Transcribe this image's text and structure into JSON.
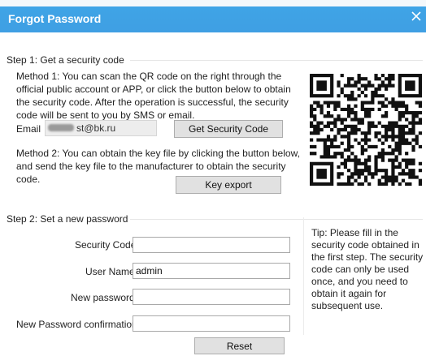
{
  "window": {
    "title": "Forgot Password",
    "close_icon": "close-icon",
    "colors": {
      "titlebar": "#3fa4e6",
      "title_text": "#ffffff"
    }
  },
  "step1": {
    "title": "Step 1: Get a security code",
    "method1_text": "Method 1: You can scan the QR code on the right through the official public account or APP, or click the button below to obtain the security code. After the operation is successful, the security code will be sent to you by SMS or email.",
    "email_label": "Email",
    "email_value": "st@bk.ru",
    "get_code_button": "Get Security Code",
    "method2_text": "Method 2: You can obtain the key file by clicking the button below, and send the key file to the manufacturer to obtain the security code.",
    "key_export_button": "Key export",
    "qr_code": "qr-code-image"
  },
  "step2": {
    "title": "Step 2: Set a new password",
    "security_code_label": "Security Code",
    "security_code_value": "",
    "user_name_label": "User Name",
    "user_name_value": "admin",
    "new_password_label": "New password",
    "new_password_value": "",
    "confirm_label": "New Password confirmation",
    "confirm_value": "",
    "reset_button": "Reset",
    "tip": "Tip: Please fill in the security code obtained in the first step. The security code can only be used once, and you need to obtain it again for subsequent use."
  }
}
